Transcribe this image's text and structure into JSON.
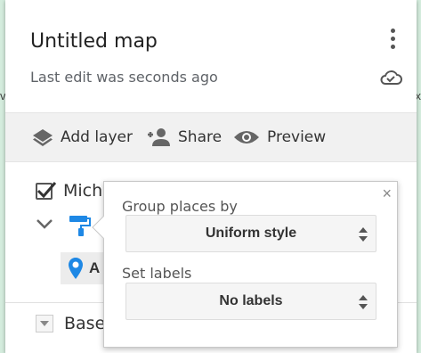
{
  "map": {
    "title": "Untitled map",
    "last_edit": "Last edit was seconds ago"
  },
  "toolbar": {
    "add_layer": "Add layer",
    "share": "Share",
    "preview": "Preview"
  },
  "layer": {
    "name": "Mich",
    "checked": true,
    "place_initial": "A"
  },
  "base_map": {
    "label": "Base"
  },
  "style_popup": {
    "group_label": "Group places by",
    "group_value": "Uniform style",
    "labels_label": "Set labels",
    "labels_value": "No labels",
    "close_glyph": "×"
  },
  "edge_text": {
    "left": "v",
    "right": "x"
  },
  "colors": {
    "accent_blue": "#1a73e8",
    "pin_blue": "#1e88e5",
    "toolbar_bg": "#f1f1f1"
  }
}
